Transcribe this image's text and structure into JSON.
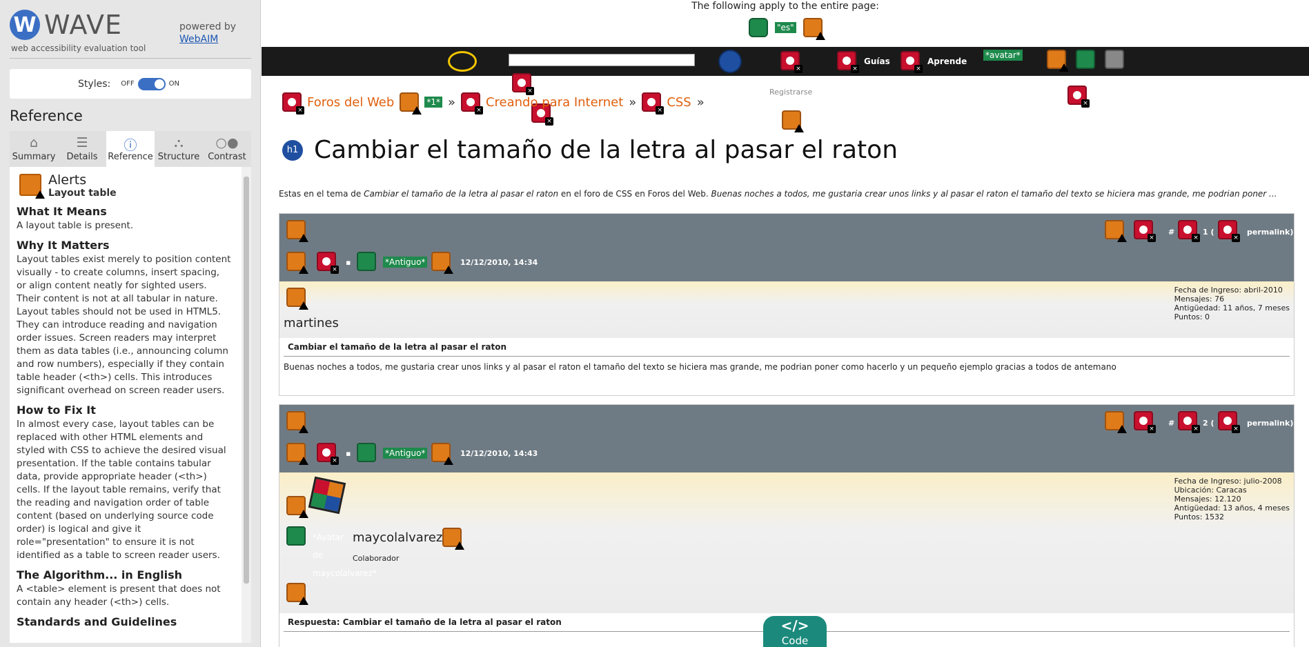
{
  "wave": {
    "logo_letter": "W",
    "logo_text": "WAVE",
    "tagline": "web accessibility evaluation tool",
    "powered_by": "powered by",
    "webaim_link": "WebAIM",
    "styles_label": "Styles:",
    "styles_off": "OFF",
    "styles_on": "ON",
    "styles_state": "on",
    "reference_title": "Reference",
    "tabs": [
      {
        "label": "Summary",
        "icon": "home-icon"
      },
      {
        "label": "Details",
        "icon": "list-icon"
      },
      {
        "label": "Reference",
        "icon": "info-icon",
        "active": true
      },
      {
        "label": "Structure",
        "icon": "structure-icon"
      },
      {
        "label": "Contrast",
        "icon": "contrast-icon"
      }
    ],
    "alert": {
      "category": "Alerts",
      "name": "Layout table",
      "what_it_means_h": "What It Means",
      "what_it_means": "A layout table is present.",
      "why_h": "Why It Matters",
      "why": "Layout tables exist merely to position content visually - to create columns, insert spacing, or align content neatly for sighted users. Their content is not at all tabular in nature. Layout tables should not be used in HTML5. They can introduce reading and navigation order issues. Screen readers may interpret them as data tables (i.e., announcing column and row numbers), especially if they contain table header (<th>) cells. This introduces significant overhead on screen reader users.",
      "fix_h": "How to Fix It",
      "fix": "In almost every case, layout tables can be replaced with other HTML elements and styled with CSS to achieve the desired visual presentation. If the table contains tabular data, provide appropriate header (<th>) cells. If the layout table remains, verify that the reading and navigation order of table content (based on underlying source code order) is logical and give it role=\"presentation\" to ensure it is not identified as a table to screen reader users.",
      "algo_h": "The Algorithm... in English",
      "algo": "A <table> element is present that does not contain any header (<th>) cells.",
      "standards_h": "Standards and Guidelines"
    }
  },
  "page": {
    "apply_text": "The following apply to the entire page:",
    "lang_badge": "\"es\"",
    "nav_guias": "Guías",
    "nav_aprende": "Aprende",
    "avatar_badge": "*avatar*",
    "registrarse": "Registrarse",
    "crumbs": [
      "Foros del Web",
      "Creando para Internet",
      "CSS"
    ],
    "crumb_badge": "*1*",
    "crumb_sep": "»",
    "h1_badge": "h1",
    "h1": "Cambiar el tamaño de la letra al pasar el raton",
    "intro_a": "Estas en el tema de ",
    "intro_title": "Cambiar el tamaño de la letra al pasar el raton",
    "intro_b": " en el foro de CSS en Foros del Web. ",
    "intro_excerpt": "Buenas noches a todos, me gustaria crear unos links y al pasar el raton el tamaño del texto se hiciera mas grande, me podrian poner ...",
    "posts": [
      {
        "badge": "*Antiguo*",
        "date": "12/12/2010, 14:34",
        "num": "# ",
        "num2": "1 (",
        "permalink": "permalink)",
        "user": "martines",
        "stats": [
          "Fecha de Ingreso: abril-2010",
          "Mensajes: 76",
          "Antigüedad: 11 años, 7 meses",
          "Puntos: 0"
        ],
        "title": "Cambiar el tamaño de la letra al pasar el raton",
        "body": "Buenas noches a todos, me gustaria crear unos links y al pasar el raton el tamaño del texto se hiciera mas grande, me podrian poner como hacerlo y un pequeño ejemplo gracias a todos de antemano"
      },
      {
        "badge": "*Antiguo*",
        "date": "12/12/2010, 14:43",
        "num": "# ",
        "num2": "2 (",
        "permalink": "permalink)",
        "user": "maycolalvarez",
        "avatar_badge": "*Avatar de maycolalvarez*",
        "role": "Colaborador",
        "stats": [
          "Fecha de Ingreso: julio-2008",
          "Ubicación: Caracas",
          "Mensajes: 12.120",
          "Antigüedad: 13 años, 4 meses",
          "Puntos: 1532"
        ],
        "title": "Respuesta: Cambiar el tamaño de la letra al pasar el raton"
      }
    ],
    "code_symbol": "</>",
    "code_label": "Code"
  }
}
